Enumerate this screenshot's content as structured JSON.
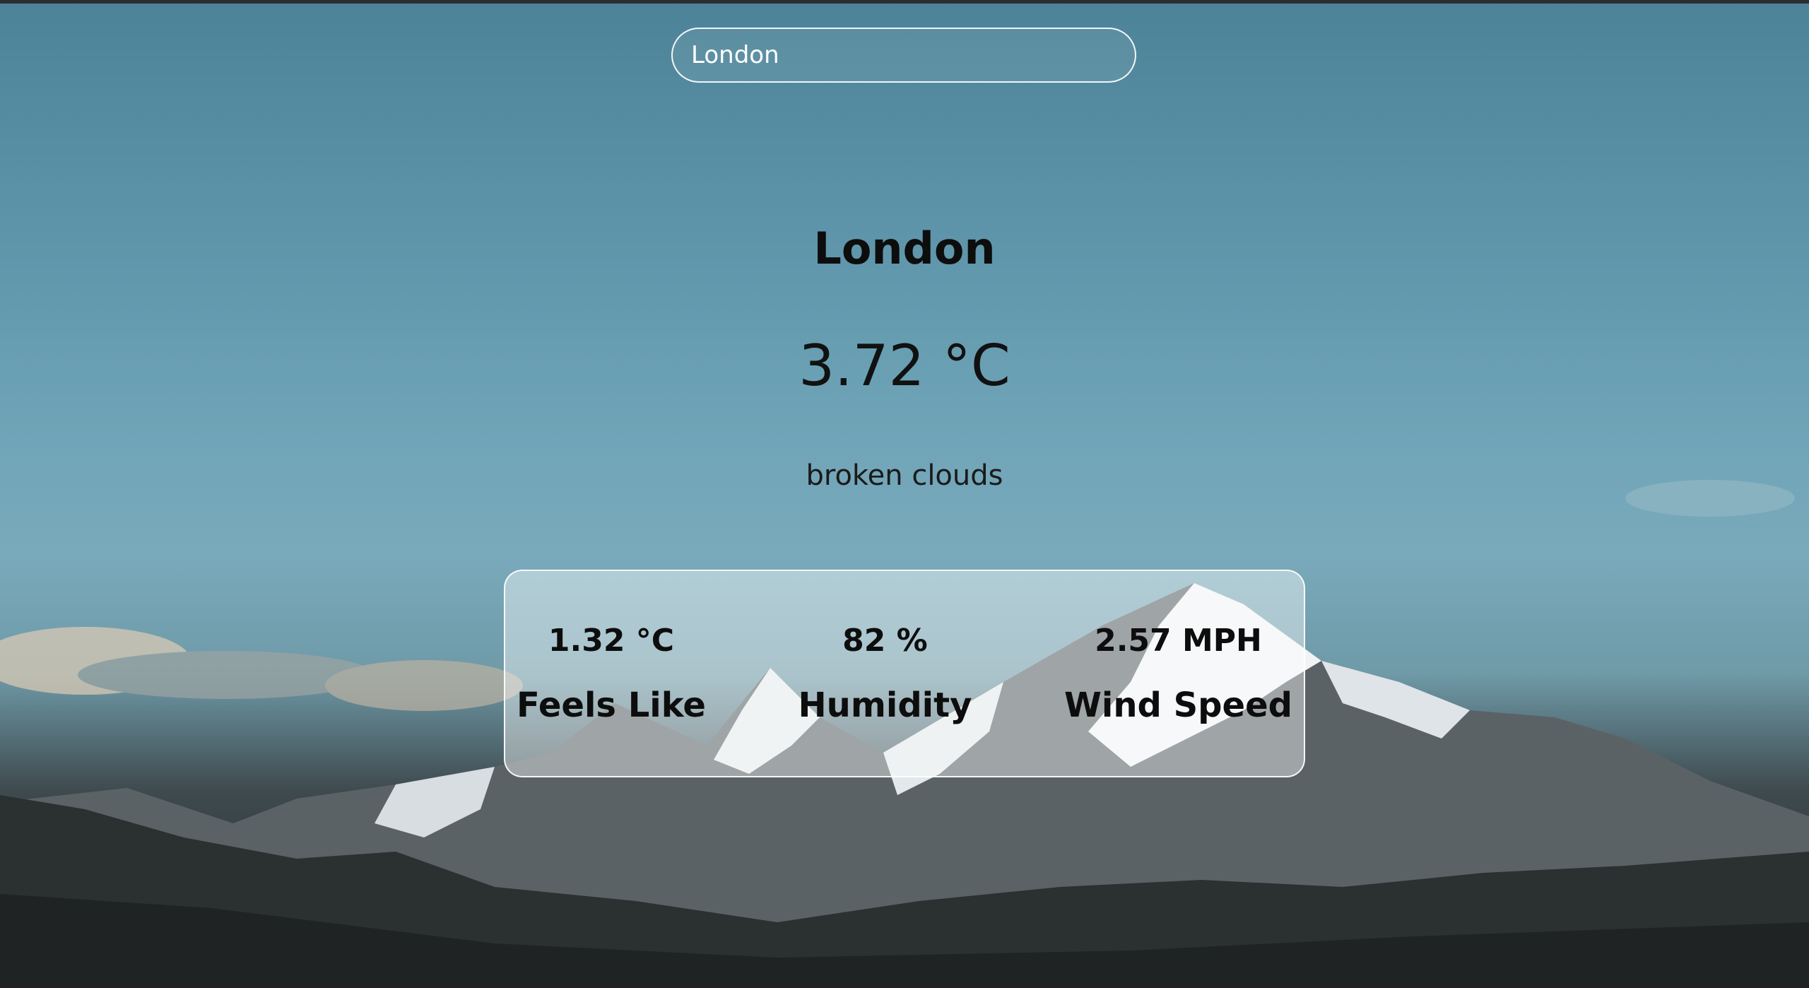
{
  "search": {
    "value": "London",
    "placeholder": ""
  },
  "weather": {
    "city": "London",
    "temperature": "3.72 °C",
    "description": "broken clouds"
  },
  "stats": [
    {
      "value": "1.32 °C",
      "label": "Feels Like"
    },
    {
      "value": "82 %",
      "label": "Humidity"
    },
    {
      "value": "2.57 MPH",
      "label": "Wind Speed"
    }
  ],
  "background": {
    "icon": "mountain-landscape-image",
    "sky_color": "#5b92a7",
    "mountain_color": "#262b2c"
  }
}
